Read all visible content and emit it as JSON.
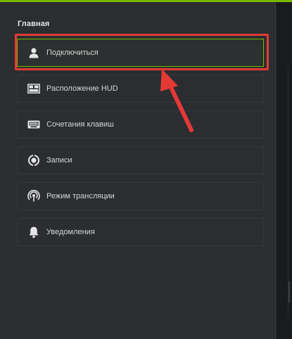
{
  "section": {
    "title": "Главная"
  },
  "menu": {
    "items": [
      {
        "id": "connect",
        "label": "Подключиться",
        "icon": "user-icon",
        "active": true
      },
      {
        "id": "hud",
        "label": "Расположение HUD",
        "icon": "hud-layout-icon",
        "active": false
      },
      {
        "id": "hotkeys",
        "label": "Сочетания клавиш",
        "icon": "keyboard-icon",
        "active": false
      },
      {
        "id": "recordings",
        "label": "Записи",
        "icon": "record-icon",
        "active": false
      },
      {
        "id": "broadcast",
        "label": "Режим трансляции",
        "icon": "broadcast-icon",
        "active": false
      },
      {
        "id": "notifications",
        "label": "Уведомления",
        "icon": "bell-icon",
        "active": false
      }
    ]
  },
  "colors": {
    "accent": "#76b900",
    "annotation": "#e53935",
    "panel": "#2b2d31",
    "text": "#d6d6d6"
  }
}
